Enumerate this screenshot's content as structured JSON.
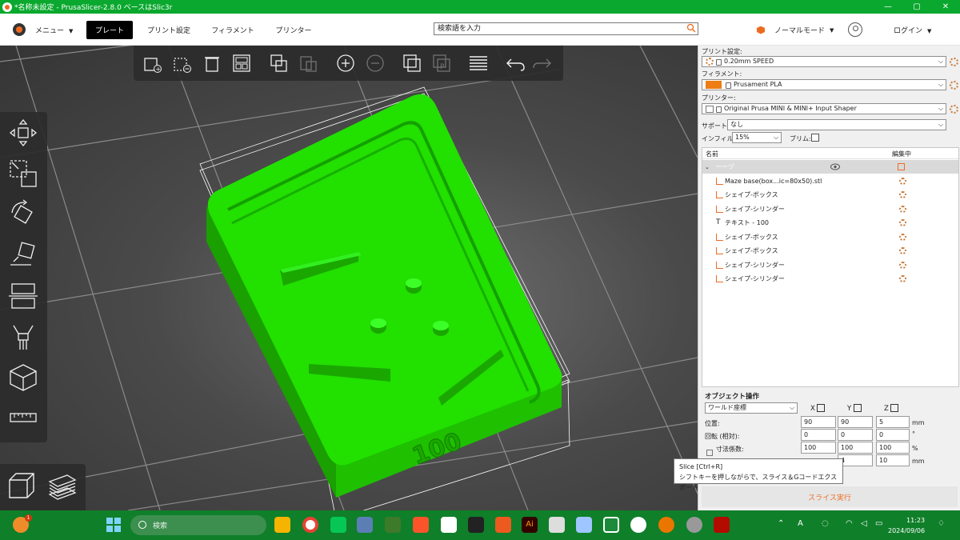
{
  "window": {
    "title": "*名称未設定 - PrusaSlicer-2.8.0 ベースはSlic3r",
    "controls": [
      "—",
      "▢",
      "✕"
    ]
  },
  "topbar": {
    "menu_label": "メニュー",
    "tabs": [
      "プレート",
      "プリント設定",
      "フィラメント",
      "プリンター"
    ],
    "search_placeholder": "検索語を入力",
    "mode_label": "ノーマルモード",
    "login_label": "ログイン"
  },
  "sidebar": {
    "print_settings_label": "プリント設定:",
    "print_settings_value": "0.20mm SPEED",
    "filament_label": "フィラメント:",
    "filament_value": "Prusament PLA",
    "printer_label": "プリンター:",
    "printer_value": "Original Prusa MINI & MINI+ Input Shaper",
    "support_label": "サポート:",
    "support_value": "なし",
    "infill_label": "インフィル:",
    "infill_value": "15%",
    "brim_label": "ブリム:"
  },
  "object_list": {
    "col_name": "名前",
    "col_editing": "編集中",
    "group_name": "ーーヅ",
    "items": [
      "Maze base(box...ic=80x50).stl",
      "シェイプ-ボックス",
      "シェイプ-シリンダー",
      "テキスト - 100",
      "シェイプ-ボックス",
      "シェイプ-ボックス",
      "シェイプ-シリンダー",
      "シェイプ-シリンダー"
    ]
  },
  "object_ops": {
    "title": "オブジェクト操作",
    "coord_system": "ワールド座標",
    "axes": [
      "X",
      "Y",
      "Z"
    ],
    "position_label": "位置:",
    "position": [
      "90",
      "90",
      "5"
    ],
    "position_unit": "mm",
    "rotation_label": "回転 (相対):",
    "rotation": [
      "0",
      "0",
      "0"
    ],
    "rotation_unit": "°",
    "scale_label": "寸法係数:",
    "scale": [
      "100",
      "100",
      "100"
    ],
    "scale_unit": "%",
    "size": [
      "4",
      "10"
    ],
    "size_unit": "mm"
  },
  "slice": {
    "button_label": "スライス実行",
    "tooltip_line1": "Slice [Ctrl+R]",
    "tooltip_line2": "シフトキーを押しながらで、スライス＆Gコードエクスポート"
  },
  "model": {
    "text_label": "100",
    "color": "#22e000"
  },
  "taskbar": {
    "search_placeholder": "検索",
    "time": "11:23",
    "date": "2024/09/06",
    "weather_badge": "1"
  },
  "colors": {
    "accent": "#ed6b21",
    "titlebar": "#0aa82e",
    "taskbar": "#0f7f2a"
  }
}
